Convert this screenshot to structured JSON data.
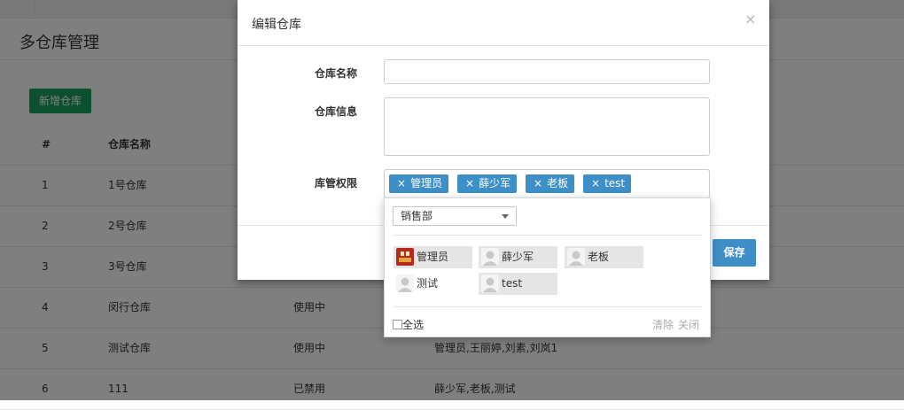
{
  "page": {
    "title": "多仓库管理",
    "add_button": "新增仓库",
    "table": {
      "headers": [
        "#",
        "仓库名称"
      ],
      "rows": [
        {
          "no": "1",
          "name": "1号仓库",
          "status": "",
          "managers": ""
        },
        {
          "no": "2",
          "name": "2号仓库",
          "status": "",
          "managers": ""
        },
        {
          "no": "3",
          "name": "3号仓库",
          "status": "",
          "managers": ""
        },
        {
          "no": "4",
          "name": "闵行仓库",
          "status": "使用中",
          "managers": ""
        },
        {
          "no": "5",
          "name": "测试仓库",
          "status": "使用中",
          "managers": "管理员,王丽婷,刘素,刘岚1"
        },
        {
          "no": "6",
          "name": "111",
          "status": "已禁用",
          "managers": "薛少军,老板,测试"
        }
      ]
    }
  },
  "modal": {
    "title": "编辑仓库",
    "close_glyph": "×",
    "fields": {
      "name_label": "仓库名称",
      "name_value": "",
      "info_label": "仓库信息",
      "info_value": "",
      "perm_label": "库管权限"
    },
    "selected_tags": [
      {
        "remove": "×",
        "label": "管理员"
      },
      {
        "remove": "×",
        "label": "薛少军"
      },
      {
        "remove": "×",
        "label": "老板"
      },
      {
        "remove": "×",
        "label": "test"
      }
    ],
    "save_label": "保存"
  },
  "picker": {
    "department": "销售部",
    "users": [
      {
        "name": "管理员",
        "selected": true,
        "avatar": "custom-avatar"
      },
      {
        "name": "薛少军",
        "selected": true,
        "avatar": "default-avatar"
      },
      {
        "name": "老板",
        "selected": true,
        "avatar": "default-avatar"
      },
      {
        "name": "测试",
        "selected": false,
        "avatar": "default-avatar"
      },
      {
        "name": "test",
        "selected": true,
        "avatar": "default-avatar"
      }
    ],
    "select_all_label": "全选",
    "clear_label": "清除",
    "close_label": "关闭"
  },
  "colors": {
    "primary": "#3e8fc7",
    "success": "#1aa15f",
    "overlay": "rgba(0,0,0,0.5)"
  }
}
